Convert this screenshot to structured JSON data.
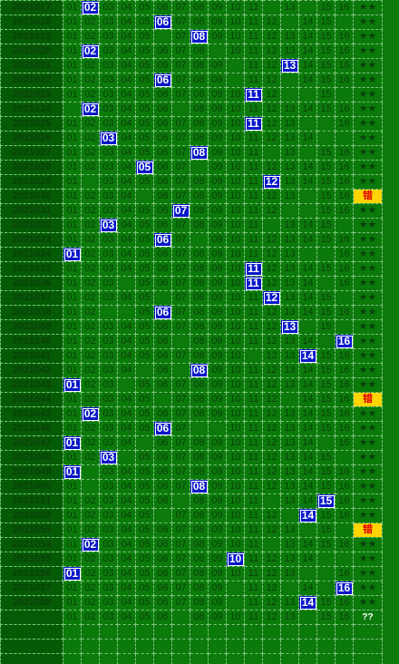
{
  "colors": {
    "background": "#0b7a0b",
    "period_cell": "#055a05",
    "hit": "#0818c7",
    "wrong_badge": "#ffd400",
    "wrong_text": "#e00000"
  },
  "labels": {
    "star": "★★",
    "wrong": "错",
    "pending": "??"
  },
  "rows": [
    {
      "period": "2021017",
      "cells": [
        "01",
        "02",
        "03",
        "04",
        "05",
        "06",
        "07",
        "08",
        "09",
        "10",
        "11",
        "",
        "13",
        "",
        "15",
        "16"
      ],
      "hits": [
        2
      ],
      "result": "star"
    },
    {
      "period": "2021018",
      "cells": [
        "01",
        "02",
        "03",
        "04",
        "05",
        "06",
        "07",
        "08",
        "09",
        "10",
        "11",
        "12",
        "",
        "14",
        "15",
        ""
      ],
      "hits": [
        6
      ],
      "result": "star"
    },
    {
      "period": "2021019",
      "cells": [
        "01",
        "02",
        "03",
        "04",
        "05",
        "",
        "07",
        "08",
        "09",
        "10",
        "11",
        "12",
        "13",
        "14",
        "15",
        "16"
      ],
      "hits": [
        8
      ],
      "result": "star"
    },
    {
      "period": "2021020",
      "cells": [
        "01",
        "02",
        "03",
        "04",
        "05",
        "06",
        "07",
        "08",
        "",
        "10",
        "11",
        "12",
        "13",
        "14",
        "15",
        "16"
      ],
      "hits": [
        2
      ],
      "result": "star"
    },
    {
      "period": "2021021",
      "cells": [
        "01",
        "02",
        "03",
        "04",
        "05",
        "06",
        "07",
        "08",
        "09",
        "",
        "11",
        "12",
        "13",
        "14",
        "15",
        "16"
      ],
      "hits": [
        13
      ],
      "result": "star"
    },
    {
      "period": "2021022",
      "cells": [
        "01",
        "02",
        "03",
        "04",
        "05",
        "06",
        "07",
        "08",
        "09",
        "",
        "11",
        "12",
        "",
        "14",
        "15",
        "16"
      ],
      "hits": [
        6
      ],
      "result": "star"
    },
    {
      "period": "2021023",
      "cells": [
        "01",
        "02",
        "03",
        "04",
        "05",
        "06",
        "07",
        "08",
        "09",
        "10",
        "11",
        "12",
        "",
        "",
        "15",
        ""
      ],
      "hits": [
        11
      ],
      "result": "star"
    },
    {
      "period": "2021024",
      "cells": [
        "",
        "02",
        "03",
        "04",
        "05",
        "06",
        "",
        "08",
        "09",
        "10",
        "11",
        "12",
        "13",
        "14",
        "15",
        "16"
      ],
      "hits": [
        2
      ],
      "result": "star"
    },
    {
      "period": "2021025",
      "cells": [
        "01",
        "02",
        "03",
        "04",
        "05",
        "06",
        "07",
        "08",
        "09",
        "10",
        "11",
        "12",
        "13",
        "",
        "",
        "16"
      ],
      "hits": [
        11
      ],
      "result": "star"
    },
    {
      "period": "2021026",
      "cells": [
        "01",
        "02",
        "03",
        "04",
        "05",
        "06",
        "07",
        "08",
        "09",
        "10",
        "11",
        "12",
        "13",
        "14",
        "",
        ""
      ],
      "hits": [
        3
      ],
      "result": "star"
    },
    {
      "period": "2021027",
      "cells": [
        "01",
        "02",
        "03",
        "04",
        "05",
        "06",
        "07",
        "08",
        "09",
        "10",
        "11",
        "",
        "13",
        "",
        "15",
        "16"
      ],
      "hits": [
        8
      ],
      "result": "star"
    },
    {
      "period": "2021028",
      "cells": [
        "01",
        "02",
        "03",
        "04",
        "05",
        "06",
        "07",
        "",
        "09",
        "10",
        "11",
        "12",
        "13",
        "14",
        "15",
        "16"
      ],
      "hits": [
        5
      ],
      "result": "star"
    },
    {
      "period": "2021029",
      "cells": [
        "01",
        "",
        "03",
        "04",
        "05",
        "06",
        "07",
        "08",
        "09",
        "10",
        "11",
        "12",
        "13",
        "14",
        "15",
        "16"
      ],
      "hits": [
        12
      ],
      "result": "star"
    },
    {
      "period": "2021030",
      "cells": [
        "01",
        "02",
        "03",
        "04",
        "",
        "06",
        "07",
        "08",
        "09",
        "10",
        "11",
        "12",
        "13",
        "",
        "15",
        "16"
      ],
      "hits": [],
      "result": "wrong"
    },
    {
      "period": "2021031",
      "cells": [
        "01",
        "02",
        "03",
        "04",
        "05",
        "06",
        "07",
        "08",
        "09",
        "10",
        "11",
        "12",
        "",
        "",
        "15",
        "16"
      ],
      "hits": [
        7
      ],
      "result": "star"
    },
    {
      "period": "2021032",
      "cells": [
        "01",
        "02",
        "03",
        "04",
        "05",
        "06",
        "07",
        "08",
        "09",
        "10",
        "11",
        "",
        "13",
        "14",
        "15",
        ""
      ],
      "hits": [
        3
      ],
      "result": "star"
    },
    {
      "period": "2021033",
      "cells": [
        "01",
        "02",
        "03",
        "04",
        "05",
        "06",
        "07",
        "",
        "09",
        "10",
        "11",
        "12",
        "13",
        "14",
        "15",
        "16"
      ],
      "hits": [
        6
      ],
      "result": "star"
    },
    {
      "period": "2021034",
      "cells": [
        "01",
        "02",
        "03",
        "04",
        "05",
        "06",
        "07",
        "08",
        "09",
        "10",
        "11",
        "12",
        "13",
        "",
        "",
        "16"
      ],
      "hits": [
        1
      ],
      "result": "star"
    },
    {
      "period": "2021035",
      "cells": [
        "01",
        "02",
        "03",
        "04",
        "05",
        "06",
        "07",
        "08",
        "09",
        "10",
        "11",
        "12",
        "13",
        "14",
        "15",
        "16"
      ],
      "hits": [
        11
      ],
      "result": "star"
    },
    {
      "period": "2021036",
      "cells": [
        "01",
        "02",
        "03",
        "",
        "05",
        "06",
        "07",
        "08",
        "09",
        "10",
        "11",
        "12",
        "13",
        "14",
        "",
        "16"
      ],
      "hits": [
        11
      ],
      "result": "star"
    },
    {
      "period": "2021037",
      "cells": [
        "01",
        "02",
        "03",
        "04",
        "05",
        "",
        "07",
        "08",
        "09",
        "10",
        "11",
        "12",
        "13",
        "14",
        "15",
        ""
      ],
      "hits": [
        12
      ],
      "result": "star"
    },
    {
      "period": "2021038",
      "cells": [
        "01",
        "02",
        "",
        "",
        "05",
        "06",
        "07",
        "08",
        "09",
        "10",
        "11",
        "12",
        "13",
        "14",
        "15",
        "16"
      ],
      "hits": [
        6
      ],
      "result": "star"
    },
    {
      "period": "2021039",
      "cells": [
        "01",
        "02",
        "03",
        "04",
        "05",
        "06",
        "07",
        "08",
        "09",
        "10",
        "11",
        "12",
        "13",
        "",
        "15",
        ""
      ],
      "hits": [
        13
      ],
      "result": "star"
    },
    {
      "period": "2021040",
      "cells": [
        "01",
        "02",
        "03",
        "04",
        "05",
        "06",
        "",
        "08",
        "09",
        "10",
        "11",
        "12",
        "13",
        "14",
        "",
        "16"
      ],
      "hits": [
        16
      ],
      "result": "star"
    },
    {
      "period": "2021041",
      "cells": [
        "01",
        "02",
        "03",
        "04",
        "05",
        "06",
        "07",
        "08",
        "09",
        "10",
        "",
        "12",
        "13",
        "14",
        "15",
        "16"
      ],
      "hits": [
        14
      ],
      "result": "star"
    },
    {
      "period": "2021042",
      "cells": [
        "01",
        "02",
        "03",
        "04",
        "",
        "06",
        "",
        "08",
        "09",
        "10",
        "11",
        "12",
        "13",
        "14",
        "15",
        "16"
      ],
      "hits": [
        8
      ],
      "result": "star"
    },
    {
      "period": "2021043",
      "cells": [
        "01",
        "02",
        "03",
        "",
        "05",
        "06",
        "07",
        "08",
        "09",
        "10",
        "11",
        "12",
        "13",
        "14",
        "15",
        "16"
      ],
      "hits": [
        1
      ],
      "result": "star"
    },
    {
      "period": "2021044",
      "cells": [
        "01",
        "02",
        "03",
        "04",
        "05",
        "",
        "07",
        "08",
        "09",
        "10",
        "11",
        "12",
        "",
        "14",
        "15",
        "16"
      ],
      "hits": [],
      "result": "wrong"
    },
    {
      "period": "2021045",
      "cells": [
        "01",
        "02",
        "03",
        "04",
        "05",
        "06",
        "07",
        "08",
        "09",
        "10",
        "11",
        "12",
        "13",
        "14",
        "15",
        "16"
      ],
      "hits": [
        2
      ],
      "result": "star"
    },
    {
      "period": "2021046",
      "cells": [
        "01",
        "02",
        "03",
        "04",
        "05",
        "06",
        "07",
        "",
        "",
        "10",
        "11",
        "12",
        "13",
        "14",
        "15",
        "16"
      ],
      "hits": [
        6
      ],
      "result": "star"
    },
    {
      "period": "2021047",
      "cells": [
        "01",
        "02",
        "03",
        "04",
        "",
        "06",
        "07",
        "08",
        "09",
        "10",
        "11",
        "12",
        "13",
        "14",
        "",
        "16"
      ],
      "hits": [
        1
      ],
      "result": "star"
    },
    {
      "period": "2021048",
      "cells": [
        "01",
        "02",
        "03",
        "",
        "05",
        "06",
        "07",
        "08",
        "09",
        "10",
        "11",
        "12",
        "13",
        "14",
        "15",
        ""
      ],
      "hits": [
        3
      ],
      "result": "star"
    },
    {
      "period": "2021049",
      "cells": [
        "01",
        "",
        "03",
        "04",
        "05",
        "06",
        "07",
        "08",
        "09",
        "10",
        "11",
        "12",
        "13",
        "14",
        "15",
        "16"
      ],
      "hits": [
        1
      ],
      "result": "star"
    },
    {
      "period": "2021050",
      "cells": [
        "01",
        "",
        "03",
        "04",
        "05",
        "06",
        "07",
        "08",
        "09",
        "10",
        "11",
        "12",
        "13",
        "14",
        "15",
        "16"
      ],
      "hits": [
        8
      ],
      "result": "star"
    },
    {
      "period": "2021051",
      "cells": [
        "01",
        "02",
        "03",
        "04",
        "05",
        "06",
        "",
        "08",
        "09",
        "10",
        "11",
        "",
        "13",
        "14",
        "15",
        "16"
      ],
      "hits": [
        15
      ],
      "result": "star"
    },
    {
      "period": "2021052",
      "cells": [
        "01",
        "02",
        "03",
        "04",
        "05",
        "",
        "07",
        "08",
        "09",
        "10",
        "11",
        "12",
        "",
        "14",
        "15",
        "16"
      ],
      "hits": [
        14
      ],
      "result": "star"
    },
    {
      "period": "2021053",
      "cells": [
        "01",
        "02",
        "03",
        "04",
        "05",
        "06",
        "07",
        "08",
        "09",
        "10",
        "11",
        "12",
        "13",
        "",
        "15",
        ""
      ],
      "hits": [],
      "result": "wrong"
    },
    {
      "period": "2021054",
      "cells": [
        "01",
        "02",
        "03",
        "04",
        "05",
        "06",
        "07",
        "08",
        "09",
        "10",
        "11",
        "",
        "13",
        "14",
        "15",
        "16"
      ],
      "hits": [
        2
      ],
      "result": "star"
    },
    {
      "period": "2021055",
      "cells": [
        "01",
        "02",
        "03",
        "04",
        "05",
        "06",
        "07",
        "08",
        "09",
        "10",
        "11",
        "12",
        "13",
        "14",
        "",
        ""
      ],
      "hits": [
        10
      ],
      "result": "star"
    },
    {
      "period": "2021056",
      "cells": [
        "01",
        "02",
        "03",
        "04",
        "05",
        "06",
        "07",
        "08",
        "09",
        "10",
        "11",
        "12",
        "13",
        "",
        "",
        "16"
      ],
      "hits": [
        1
      ],
      "result": "star"
    },
    {
      "period": "2021057",
      "cells": [
        "01",
        "02",
        "03",
        "04",
        "05",
        "06",
        "07",
        "08",
        "09",
        "",
        "11",
        "12",
        "",
        "14",
        "",
        "16"
      ],
      "hits": [
        16
      ],
      "result": "star"
    },
    {
      "period": "2021058",
      "cells": [
        "01",
        "02",
        "03",
        "04",
        "05",
        "06",
        "07",
        "08",
        "09",
        "",
        "11",
        "12",
        "13",
        "14",
        "15",
        "16"
      ],
      "hits": [
        14
      ],
      "result": "star"
    },
    {
      "period": "",
      "cells": [
        "01",
        "02",
        "03",
        "04",
        "05",
        "06",
        "",
        "08",
        "09",
        "10",
        "11",
        "12",
        "13",
        "",
        "15",
        "16"
      ],
      "hits": [],
      "result": "pending"
    }
  ],
  "blank_rows": 3
}
